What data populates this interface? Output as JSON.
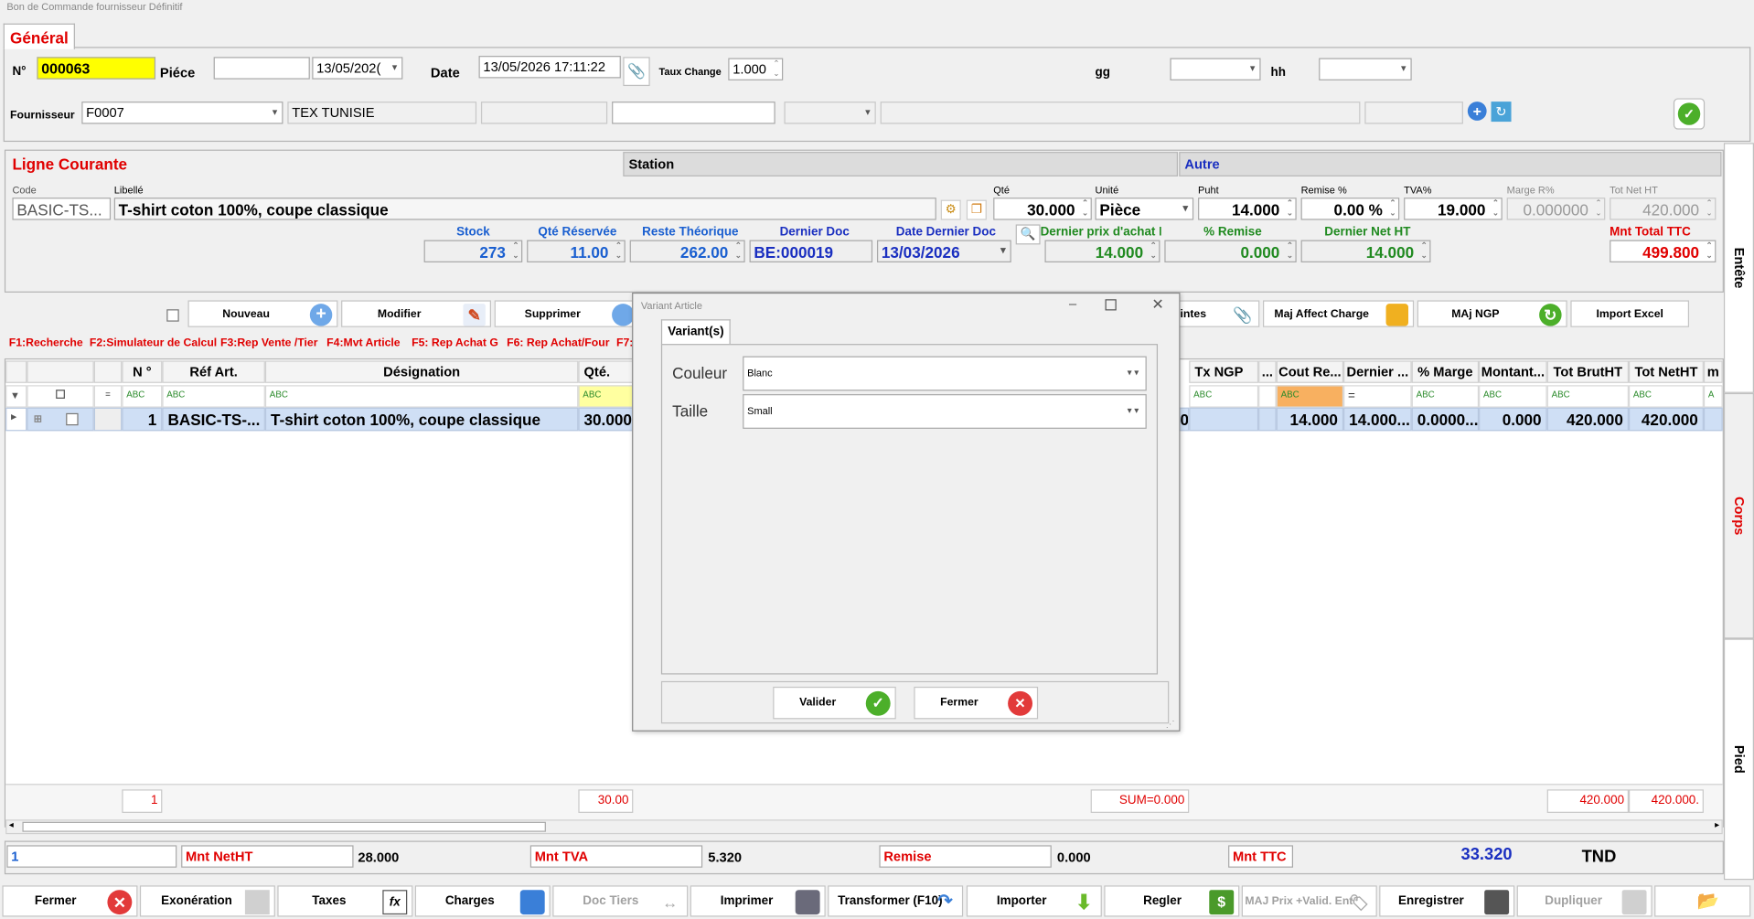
{
  "window": {
    "title": "Bon de Commande fournisseur Définitif"
  },
  "general": {
    "tab_label": "Général",
    "numero_label": "N°",
    "numero_value": "000063",
    "piece_label": "Piéce",
    "piece_value": "",
    "piece_date": "13/05/202(",
    "date_label": "Date",
    "date_value": "13/05/2026 17:11:22",
    "taux_label": "Taux Change",
    "taux_value": "1.000",
    "gg_label": "gg",
    "hh_label": "hh",
    "fournisseur_label": "Fournisseur",
    "fournisseur_code": "F0007",
    "fournisseur_name": "TEX TUNISIE"
  },
  "ligne": {
    "title": "Ligne Courante",
    "station_label": "Station",
    "autre_label": "Autre",
    "code_label": "Code",
    "code_value": "BASIC-TS...",
    "libelle_label": "Libellé",
    "libelle_value": "T-shirt coton 100%, coupe classique",
    "qte_label": "Qté",
    "qte_value": "30.000",
    "unite_label": "Unité",
    "unite_value": "Pièce",
    "puht_label": "Puht",
    "puht_value": "14.000",
    "remise_label": "Remise %",
    "remise_value": "0.00 %",
    "tva_label": "TVA%",
    "tva_value": "19.000",
    "marge_label": "Marge R%",
    "marge_value": "0.000000",
    "totnet_label": "Tot Net HT",
    "totnet_value": "420.000",
    "stock_label": "Stock",
    "stock_value": "273",
    "qte_reservee_label": "Qté Réservée",
    "qte_reservee_value": "11.00",
    "reste_label": "Reste Théorique",
    "reste_value": "262.00",
    "dernier_doc_label": "Dernier Doc",
    "dernier_doc_value": "BE:000019",
    "date_dernier_label": "Date Dernier Doc",
    "date_dernier_value": "13/03/2026",
    "dernier_prix_label": "Dernier prix d'achat H",
    "dernier_prix_value": "14.000",
    "pct_remise_label": "% Remise",
    "pct_remise_value": "0.000",
    "dernier_net_label": "Dernier Net HT",
    "dernier_net_value": "14.000",
    "mnt_total_label": "Mnt Total  TTC",
    "mnt_total_value": "499.800"
  },
  "actions": {
    "nouveau": "Nouveau",
    "modifier": "Modifier",
    "supprimer": "Supprimer",
    "pieces_jointes": "intes",
    "maj_affect": "Maj Affect Charge",
    "maj_ngp": "MAj NGP",
    "import_excel": "Import Excel"
  },
  "fkeys": [
    "F1:Recherche",
    "F2:Simulateur de Calcul",
    "F3:Rep Vente /Tier",
    "F4:Mvt Article",
    "F5: Rep Achat G",
    "F6: Rep Achat/Four",
    "F7:"
  ],
  "grid": {
    "headers": [
      "N °",
      "Réf Art.",
      "Désignation",
      "Qté.",
      "Tx NGP",
      "...",
      "Cout Re...",
      "Dernier ...",
      "% Marge",
      "Montant...",
      "Tot BrutHT",
      "Tot NetHT",
      "m"
    ],
    "row": {
      "n": "1",
      "ref": "BASIC-TS-...",
      "designation": "T-shirt coton 100%, coupe classique",
      "qte": "30.000",
      "hidden_tail": "0",
      "cout": "14.000",
      "dernier": "14.000...",
      "marge": "0.0000...",
      "montant": "0.000",
      "brut": "420.000",
      "net": "420.000"
    },
    "footer": {
      "count": "1",
      "qte_sum": "30.00",
      "sum": "SUM=0.000",
      "brut_sum": "420.000",
      "net_sum": "420.000."
    }
  },
  "totals": {
    "count": "1",
    "mnt_netht_label": "Mnt NetHT",
    "mnt_netht_value": "28.000",
    "mnt_tva_label": "Mnt TVA",
    "mnt_tva_value": "5.320",
    "remise_label": "Remise",
    "remise_value": "0.000",
    "mnt_ttc_label": "Mnt TTC",
    "mnt_ttc_value": "33.320",
    "currency": "TND"
  },
  "side_tabs": {
    "entete": "Entête",
    "corps": "Corps",
    "pied": "Pied"
  },
  "dialog": {
    "title": "Variant Article",
    "tab": "Variant(s)",
    "couleur_label": "Couleur",
    "couleur_value": "Blanc",
    "taille_label": "Taille",
    "taille_value": "Small",
    "valider": "Valider",
    "fermer": "Fermer"
  },
  "bottom": {
    "fermer": "Fermer",
    "exoneration": "Exonération",
    "taxes": "Taxes",
    "charges": "Charges",
    "doc_tiers": "Doc Tiers",
    "imprimer": "Imprimer",
    "transformer": "Transformer (F10)",
    "importer": "Importer",
    "regler": "Regler",
    "maj_prix": "MAJ Prix +Valid. Ent",
    "enregistrer": "Enregistrer",
    "dupliquer": "Dupliquer"
  }
}
